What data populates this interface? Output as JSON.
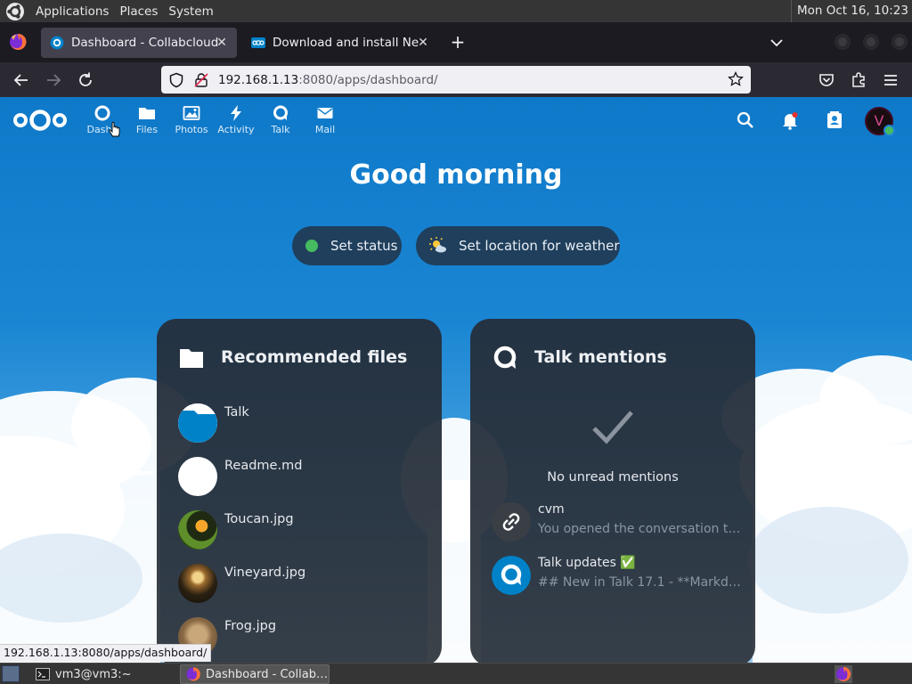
{
  "top_panel": {
    "menus": [
      "Applications",
      "Places",
      "System"
    ],
    "clock": "Mon Oct 16, 10:23"
  },
  "browser": {
    "tabs": [
      {
        "title": "Dashboard - Collabcloud",
        "active": true
      },
      {
        "title": "Download and install Nextc",
        "active": false
      }
    ],
    "new_tab_label": "+",
    "url_host": "192.168.1.13",
    "url_rest": ":8080/apps/dashboard/"
  },
  "nextcloud": {
    "apps": [
      {
        "label": "Dashb",
        "icon": "dashboard-icon"
      },
      {
        "label": "Files",
        "icon": "folder-icon"
      },
      {
        "label": "Photos",
        "icon": "image-icon"
      },
      {
        "label": "Activity",
        "icon": "lightning-icon"
      },
      {
        "label": "Talk",
        "icon": "talk-icon"
      },
      {
        "label": "Mail",
        "icon": "mail-icon"
      }
    ],
    "avatar_initial": "V",
    "greeting": "Good morning",
    "set_status": "Set status",
    "set_weather": "Set location for weather"
  },
  "recommended_files": {
    "title": "Recommended files",
    "items": [
      {
        "name": "Talk",
        "kind": "folder"
      },
      {
        "name": "Readme.md",
        "kind": "document"
      },
      {
        "name": "Toucan.jpg",
        "kind": "image"
      },
      {
        "name": "Vineyard.jpg",
        "kind": "image"
      },
      {
        "name": "Frog.jpg",
        "kind": "image"
      }
    ]
  },
  "talk_mentions": {
    "title": "Talk mentions",
    "empty_text": "No unread mentions",
    "items": [
      {
        "title": "cvm",
        "subtitle": "You opened the conversation t…",
        "icon": "link-icon"
      },
      {
        "title": "Talk updates ✅",
        "subtitle": "## New in Talk 17.1 - **Markd…",
        "icon": "talk-icon"
      }
    ]
  },
  "status_bar_url": "192.168.1.13:8080/apps/dashboard/",
  "taskbar": {
    "items": [
      {
        "label": "vm3@vm3:~",
        "active": false
      },
      {
        "label": "Dashboard - Collab…",
        "active": true
      }
    ]
  },
  "colors": {
    "nextcloud_blue": "#0f79c9",
    "panel_bg": "#25303c",
    "online_green": "#46ba61"
  }
}
